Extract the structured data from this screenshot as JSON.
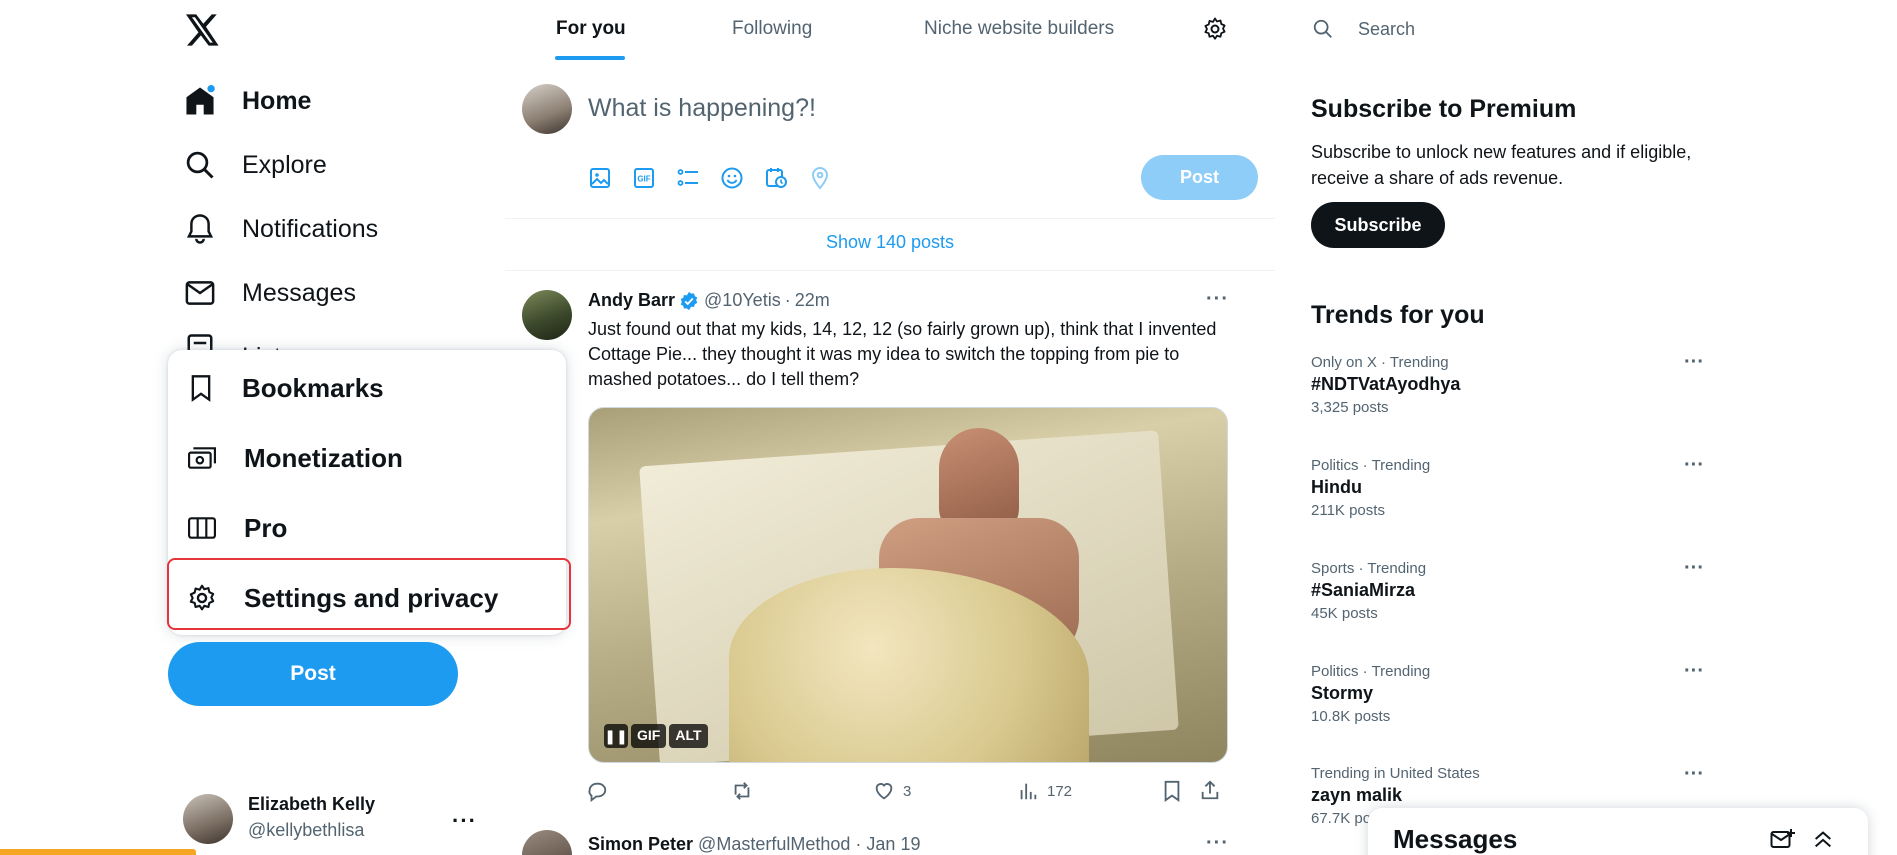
{
  "left_nav": {
    "items": [
      {
        "label": "Home",
        "icon": "home-icon"
      },
      {
        "label": "Explore",
        "icon": "search-icon"
      },
      {
        "label": "Notifications",
        "icon": "bell-icon"
      },
      {
        "label": "Messages",
        "icon": "envelope-icon"
      },
      {
        "label": "Lists",
        "icon": "list-icon"
      }
    ],
    "more_menu": [
      {
        "label": "Bookmarks",
        "icon": "bookmark-icon"
      },
      {
        "label": "Monetization",
        "icon": "money-icon"
      },
      {
        "label": "Pro",
        "icon": "columns-icon"
      },
      {
        "label": "Settings and privacy",
        "icon": "gear-icon"
      }
    ],
    "post_button": "Post",
    "account": {
      "name": "Elizabeth Kelly",
      "handle": "@kellybethlisa"
    }
  },
  "timeline": {
    "tabs": [
      "For you",
      "Following",
      "Niche website builders"
    ],
    "active_tab": "For you",
    "composer": {
      "placeholder": "What is happening?!",
      "post_label": "Post"
    },
    "show_posts": "Show 140 posts",
    "tweets": [
      {
        "name": "Andy Barr",
        "verified": true,
        "handle": "@10Yetis",
        "time": "22m",
        "text": "Just found out that my kids, 14, 12, 12 (so fairly grown up), think that I invented Cottage Pie... they thought it was my idea to switch the topping from pie to mashed potatoes... do I tell them?",
        "media_badges": {
          "gif": "GIF",
          "alt": "ALT"
        },
        "likes": "3",
        "views": "172"
      },
      {
        "name": "Simon Peter",
        "handle": "@MasterfulMethod",
        "time": "Jan 19"
      }
    ]
  },
  "sidebar": {
    "search_placeholder": "Search",
    "premium": {
      "title": "Subscribe to Premium",
      "text": "Subscribe to unlock new features and if eligible, receive a share of ads revenue.",
      "button": "Subscribe"
    },
    "trends_title": "Trends for you",
    "trends": [
      {
        "category": "Only on X · Trending",
        "name": "#NDTVatAyodhya",
        "count": "3,325 posts"
      },
      {
        "category": "Politics · Trending",
        "name": "Hindu",
        "count": "211K posts"
      },
      {
        "category": "Sports · Trending",
        "name": "#SaniaMirza",
        "count": "45K posts"
      },
      {
        "category": "Politics · Trending",
        "name": "Stormy",
        "count": "10.8K posts"
      },
      {
        "category": "Trending in United States",
        "name": "zayn malik",
        "count": "67.7K po"
      }
    ],
    "messages_drawer": "Messages"
  },
  "colors": {
    "accent": "#1d9bf0",
    "text": "#0f1419",
    "muted": "#536471",
    "highlight_border": "#e5343a"
  }
}
